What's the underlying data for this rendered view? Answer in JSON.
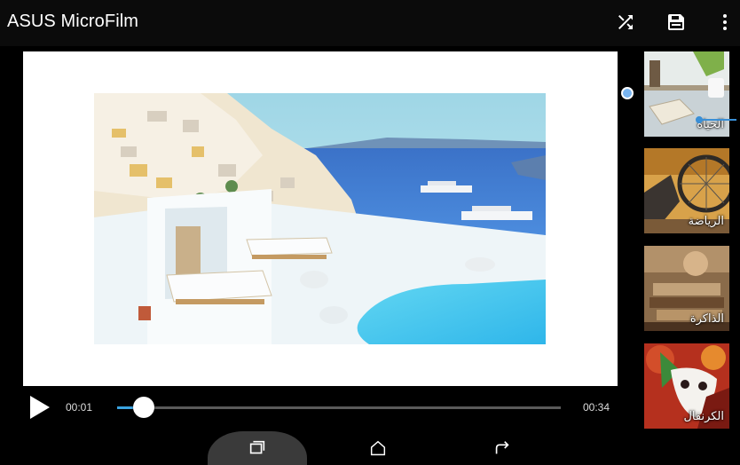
{
  "app": {
    "title": "ASUS MicroFilm"
  },
  "toolbar": {
    "shuffle_icon": "shuffle-icon",
    "save_icon": "save-icon",
    "more_icon": "more-vert-icon"
  },
  "player": {
    "current_time": "00:01",
    "total_time": "00:34",
    "progress": 0.06,
    "accent_color": "#3aa3e0"
  },
  "themes": {
    "items": [
      {
        "label": "الحياة",
        "selected": true
      },
      {
        "label": "الرياضة",
        "selected": false
      },
      {
        "label": "الذاكرة",
        "selected": false
      },
      {
        "label": "الكرنفال",
        "selected": false
      }
    ],
    "selection_color": "#58a6e6"
  },
  "navbar": {
    "recent_icon": "recent-apps-icon",
    "home_icon": "home-icon",
    "back_icon": "back-icon"
  }
}
